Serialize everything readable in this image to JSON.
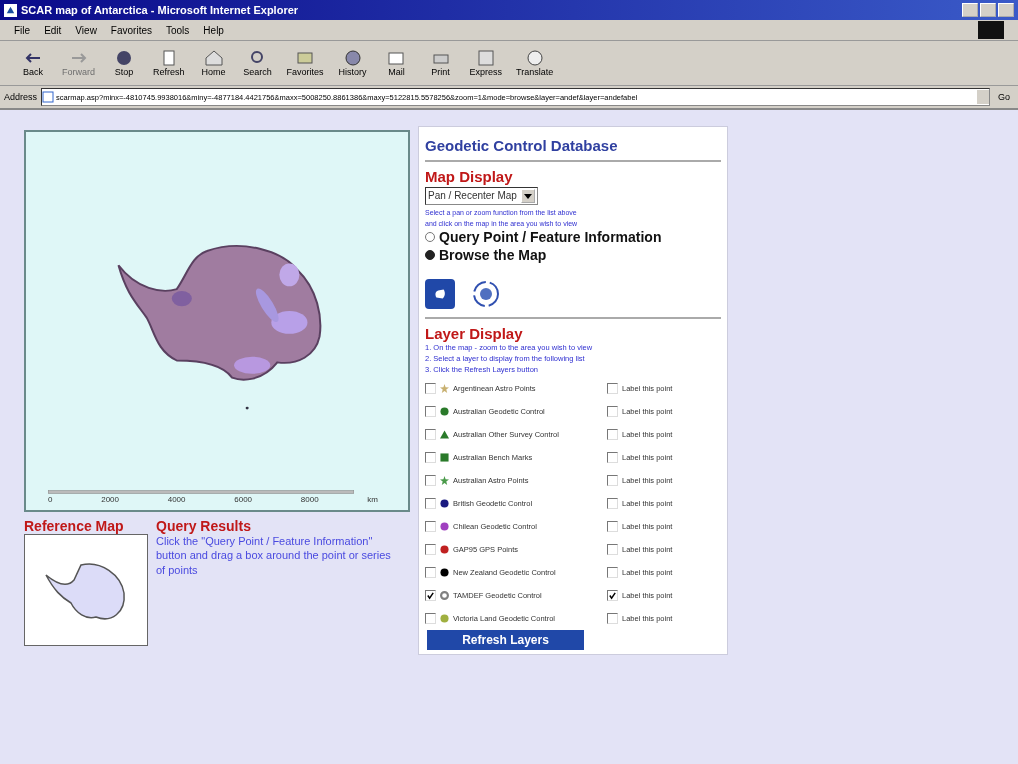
{
  "window": {
    "title": "SCAR map of Antarctica - Microsoft Internet Explorer"
  },
  "menu": [
    "File",
    "Edit",
    "View",
    "Favorites",
    "Tools",
    "Help"
  ],
  "toolbar": [
    {
      "label": "Back",
      "kind": "back",
      "disabled": false
    },
    {
      "label": "Forward",
      "kind": "forward",
      "disabled": true
    },
    {
      "label": "Stop",
      "kind": "stop",
      "disabled": false
    },
    {
      "label": "Refresh",
      "kind": "refresh",
      "disabled": false
    },
    {
      "label": "Home",
      "kind": "home",
      "disabled": false
    },
    {
      "label": "Search",
      "kind": "search",
      "disabled": false
    },
    {
      "label": "Favorites",
      "kind": "favorites",
      "disabled": false
    },
    {
      "label": "History",
      "kind": "history",
      "disabled": false
    },
    {
      "label": "Mail",
      "kind": "mail",
      "disabled": false
    },
    {
      "label": "Print",
      "kind": "print",
      "disabled": false
    },
    {
      "label": "Express",
      "kind": "express",
      "disabled": false
    },
    {
      "label": "Translate",
      "kind": "translate",
      "disabled": false
    }
  ],
  "address": {
    "label": "Address",
    "value": "scarmap.asp?minx=-4810745.9938016&miny=-4877184.4421756&maxx=5008250.8861386&maxy=5122815.5578256&zoom=1&mode=browse&layer=andef&layer=andefabel",
    "go": "Go"
  },
  "map": {
    "scale_ticks": [
      "0",
      "2000",
      "4000",
      "6000",
      "8000"
    ],
    "scale_unit": "km"
  },
  "reference_map": {
    "title": "Reference Map"
  },
  "query_results": {
    "title": "Query Results",
    "text": "Click the \"Query Point / Feature Information\" button and drag a box around the point or series of points"
  },
  "panel": {
    "title": "Geodetic Control Database",
    "map_display": {
      "title": "Map Display",
      "dropdown": "Pan / Recenter Map",
      "hint_1": "Select a pan or zoom function from the list above",
      "hint_2": "and click on the map in the area you wish to view",
      "modes": [
        {
          "label": "Query Point / Feature Information",
          "selected": false
        },
        {
          "label": "Browse the Map",
          "selected": true
        }
      ]
    },
    "layer_display": {
      "title": "Layer Display",
      "steps": [
        "1. On the map - zoom to the area you wish to view",
        "2. Select a layer to display from the following list",
        "3. Click the Refresh Layers button"
      ],
      "layers": [
        {
          "name": "Argentinean Astro Points",
          "kind": "star",
          "color": "#c8b070",
          "checked": false,
          "label": "Label this point",
          "label_checked": false
        },
        {
          "name": "Australian Geodetic Control",
          "kind": "circle",
          "color": "#2a7a2a",
          "checked": false,
          "label": "Label this point",
          "label_checked": false
        },
        {
          "name": "Australian Other Survey Control",
          "kind": "triangle",
          "color": "#2a7a2a",
          "checked": false,
          "label": "Label this point",
          "label_checked": false
        },
        {
          "name": "Australian Bench Marks",
          "kind": "square",
          "color": "#2a7a2a",
          "checked": false,
          "label": "Label this point",
          "label_checked": false
        },
        {
          "name": "Australian Astro Points",
          "kind": "star",
          "color": "#4a9a4a",
          "checked": false,
          "label": "Label this point",
          "label_checked": false
        },
        {
          "name": "British Geodetic Control",
          "kind": "circle",
          "color": "#1a1a80",
          "checked": false,
          "label": "Label this point",
          "label_checked": false
        },
        {
          "name": "Chilean Geodetic Control",
          "kind": "circle",
          "color": "#a040c0",
          "checked": false,
          "label": "Label this point",
          "label_checked": false
        },
        {
          "name": "GAP95 GPS Points",
          "kind": "circle",
          "color": "#c02020",
          "checked": false,
          "label": "Label this point",
          "label_checked": false
        },
        {
          "name": "New Zealand Geodetic Control",
          "kind": "circle",
          "color": "#000000",
          "checked": false,
          "label": "Label this point",
          "label_checked": false
        },
        {
          "name": "TAMDEF Geodetic Control",
          "kind": "ring",
          "color": "#808080",
          "checked": true,
          "label": "Label this point",
          "label_checked": true
        },
        {
          "name": "Victoria Land Geodetic Control",
          "kind": "circle",
          "color": "#a0b040",
          "checked": false,
          "label": "Label this point",
          "label_checked": false
        }
      ],
      "button": "Refresh Layers"
    }
  }
}
